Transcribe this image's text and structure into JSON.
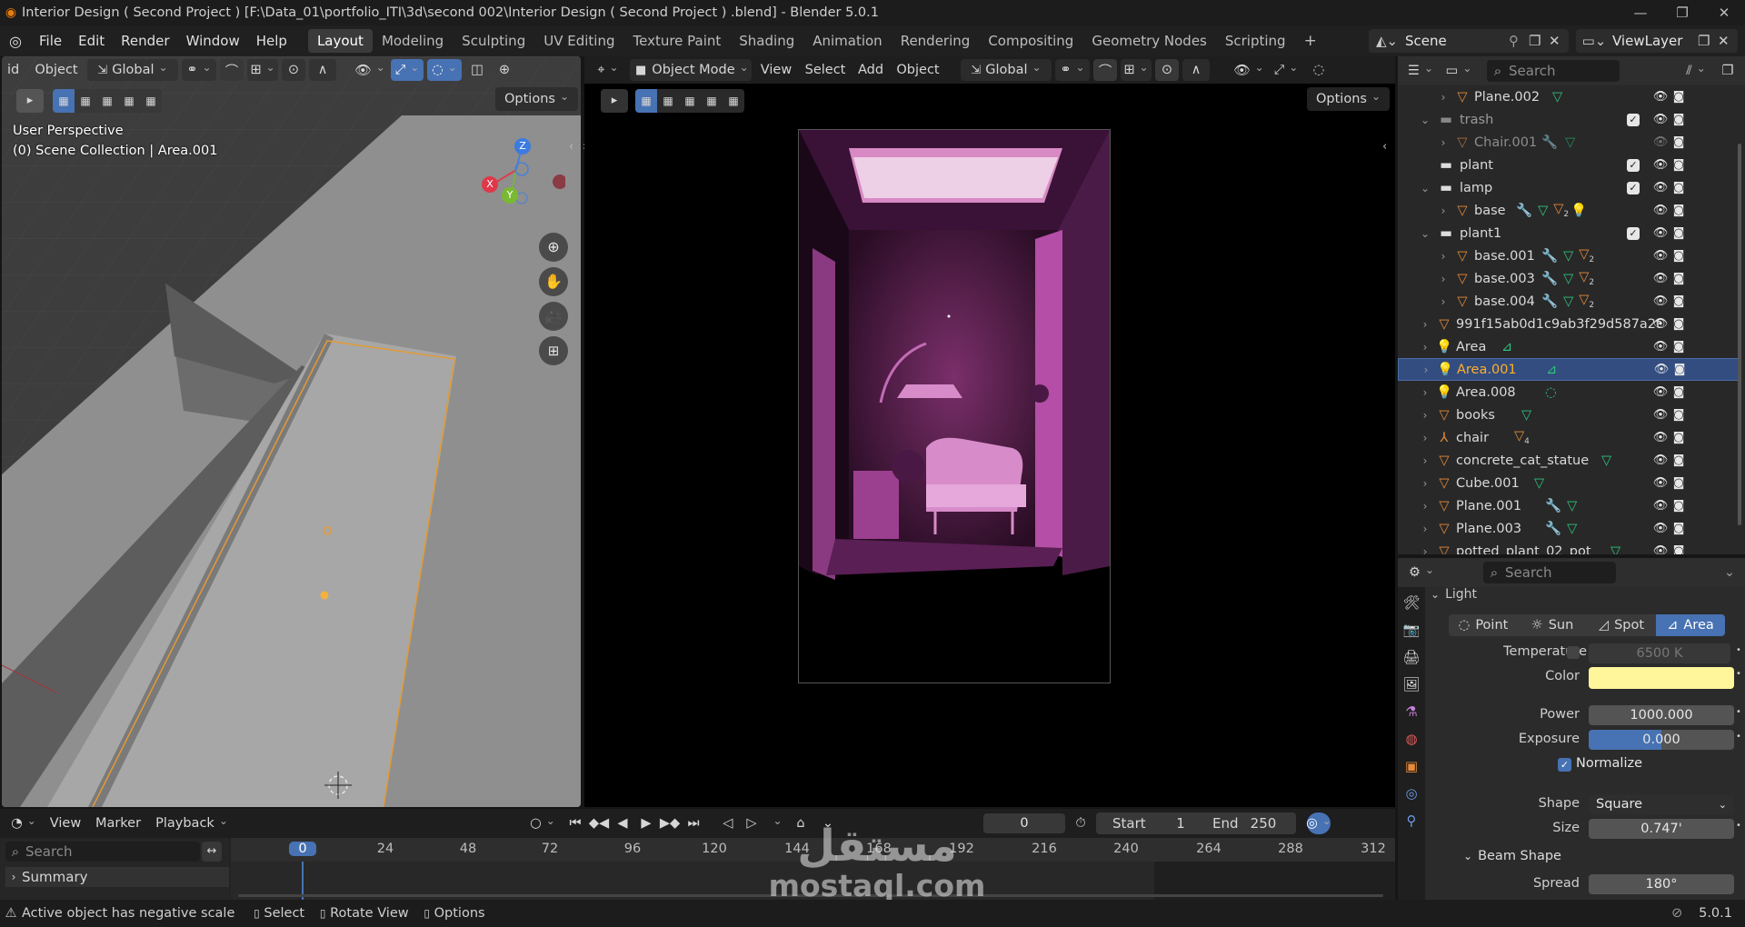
{
  "window": {
    "title": "Interior Design ( Second Project )  [F:\\Data_01\\portfolio_ITI\\3d\\second 002\\Interior Design ( Second Project ) .blend] - Blender 5.0.1"
  },
  "menu": [
    "File",
    "Edit",
    "Render",
    "Window",
    "Help"
  ],
  "workspaces": [
    "Layout",
    "Modeling",
    "Sculpting",
    "UV Editing",
    "Texture Paint",
    "Shading",
    "Animation",
    "Rendering",
    "Compositing",
    "Geometry Nodes",
    "Scripting"
  ],
  "scene": {
    "label": "Scene",
    "viewlayer": "ViewLayer"
  },
  "left_viewport": {
    "header": {
      "object": "Object",
      "transform": "Global",
      "options": "Options",
      "cut_label": "id"
    },
    "info": {
      "line1": "User Perspective",
      "line2": "(0) Scene Collection | Area.001"
    },
    "gizmo": {
      "x": "X",
      "y": "Y",
      "z": "Z"
    }
  },
  "center_viewport": {
    "header": {
      "mode": "Object Mode",
      "view": "View",
      "select": "Select",
      "add": "Add",
      "object": "Object",
      "transform": "Global",
      "options": "Options"
    }
  },
  "outliner": {
    "search_placeholder": "Search",
    "rows": [
      {
        "name": "Plane.002"
      },
      {
        "name": "trash"
      },
      {
        "name": "Chair.001"
      },
      {
        "name": "plant"
      },
      {
        "name": "lamp"
      },
      {
        "name": "base",
        "sub": "2"
      },
      {
        "name": "plant1"
      },
      {
        "name": "base.001",
        "sub": "2"
      },
      {
        "name": "base.003",
        "sub": "2"
      },
      {
        "name": "base.004",
        "sub": "2"
      },
      {
        "name": "991f15ab0d1c9ab3f29d587a2t"
      },
      {
        "name": "Area"
      },
      {
        "name": "Area.001"
      },
      {
        "name": "Area.008"
      },
      {
        "name": "books"
      },
      {
        "name": "chair",
        "sub": "4"
      },
      {
        "name": "concrete_cat_statue"
      },
      {
        "name": "Cube.001"
      },
      {
        "name": "Plane.001"
      },
      {
        "name": "Plane.003"
      },
      {
        "name": "potted_plant_02_pot"
      }
    ]
  },
  "properties": {
    "search_placeholder": "Search",
    "section": "Light",
    "types": [
      "Point",
      "Sun",
      "Spot",
      "Area"
    ],
    "active_type": "Area",
    "temperature_label": "Temperature",
    "temperature_value": "6500 K",
    "color_label": "Color",
    "color_value": "#fff59a",
    "power_label": "Power",
    "power_value": "1000.000",
    "exposure_label": "Exposure",
    "exposure_value": "0.000",
    "normalize_label": "Normalize",
    "shape_label": "Shape",
    "shape_value": "Square",
    "size_label": "Size",
    "size_value": "0.747'",
    "beam_label": "Beam Shape",
    "spread_label": "Spread",
    "spread_value": "180°"
  },
  "timeline": {
    "view": "View",
    "marker": "Marker",
    "playback": "Playback",
    "current_frame": "0",
    "start_label": "Start",
    "start": "1",
    "end_label": "End",
    "end": "250",
    "search_placeholder": "Search",
    "summary": "Summary",
    "ticks": [
      "0",
      "24",
      "48",
      "72",
      "96",
      "120",
      "144",
      "168",
      "192",
      "216",
      "240",
      "264",
      "288",
      "312"
    ]
  },
  "statusbar": {
    "warning": "Active object has negative scale",
    "select": "Select",
    "rotate": "Rotate View",
    "options": "Options",
    "version": "5.0.1"
  },
  "watermark": {
    "arabic": "مستقل",
    "latin": "mostaql.com"
  }
}
